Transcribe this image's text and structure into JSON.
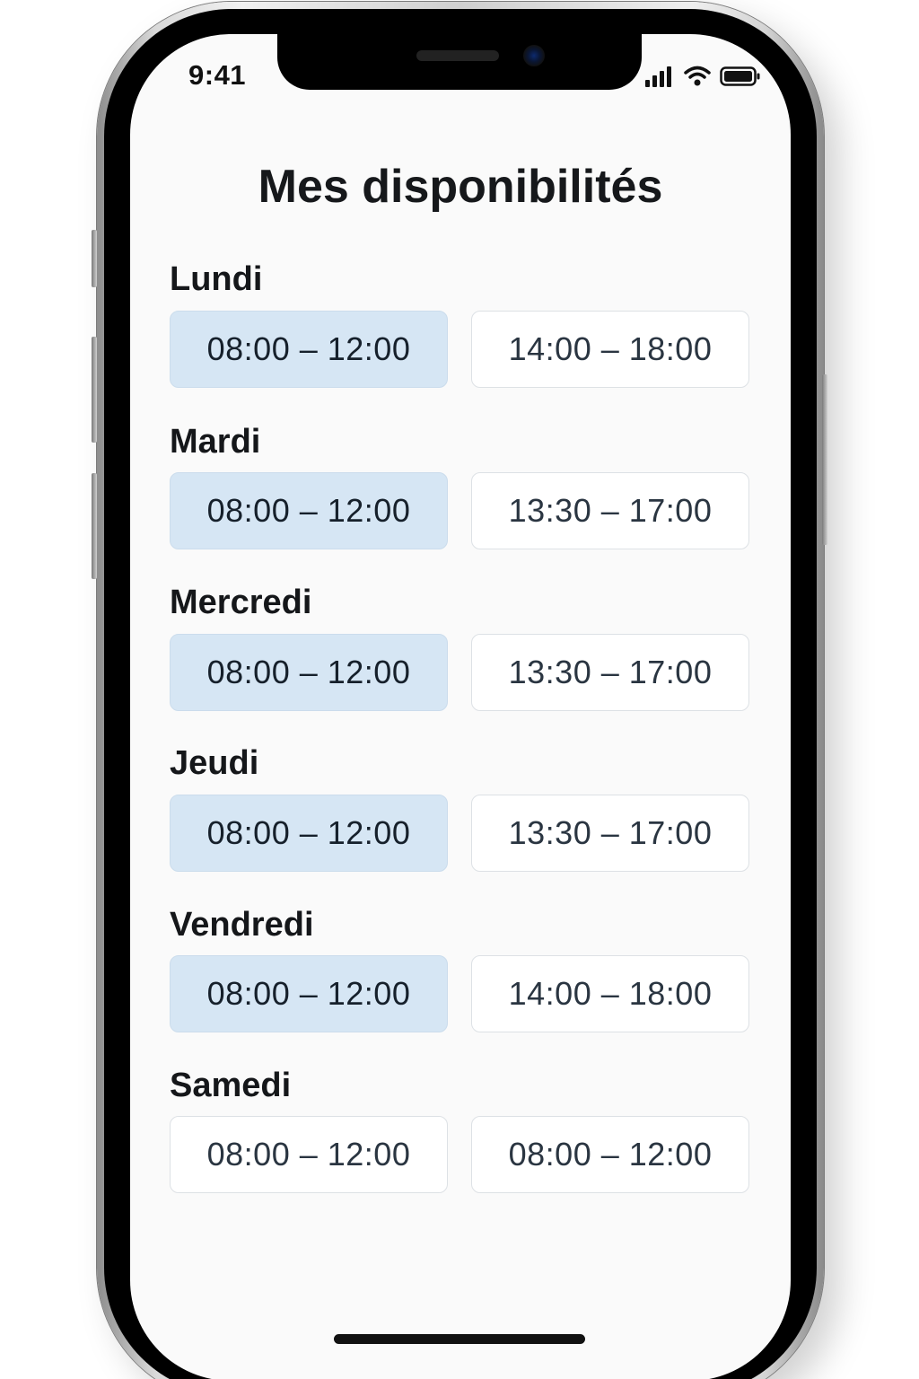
{
  "status_bar": {
    "time": "9:41",
    "icons": [
      "signal-icon",
      "wifi-icon",
      "battery-icon"
    ]
  },
  "screen": {
    "title": "Mes disponibilités"
  },
  "days": [
    {
      "label": "Lundi",
      "slots": [
        {
          "text": "08:00 – 12:00",
          "selected": true
        },
        {
          "text": "14:00 – 18:00",
          "selected": false
        }
      ]
    },
    {
      "label": "Mardi",
      "slots": [
        {
          "text": "08:00 – 12:00",
          "selected": true
        },
        {
          "text": "13:30 – 17:00",
          "selected": false
        }
      ]
    },
    {
      "label": "Mercredi",
      "slots": [
        {
          "text": "08:00 – 12:00",
          "selected": true
        },
        {
          "text": "13:30 – 17:00",
          "selected": false
        }
      ]
    },
    {
      "label": "Jeudi",
      "slots": [
        {
          "text": "08:00 – 12:00",
          "selected": true
        },
        {
          "text": "13:30 – 17:00",
          "selected": false
        }
      ]
    },
    {
      "label": "Vendredi",
      "slots": [
        {
          "text": "08:00 – 12:00",
          "selected": true
        },
        {
          "text": "14:00 – 18:00",
          "selected": false
        }
      ]
    },
    {
      "label": "Samedi",
      "slots": [
        {
          "text": "08:00 – 12:00",
          "selected": false
        },
        {
          "text": "08:00 – 12:00",
          "selected": false
        }
      ]
    }
  ],
  "colors": {
    "selected_slot_bg": "#d6e6f4",
    "unselected_slot_bg": "#ffffff",
    "text": "#16181b"
  }
}
